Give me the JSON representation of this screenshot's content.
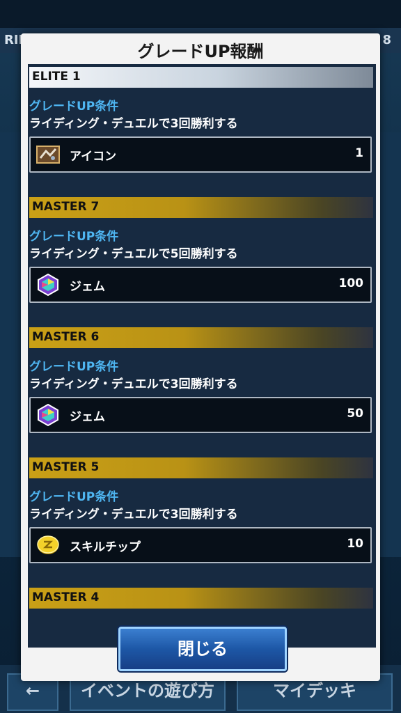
{
  "background": {
    "header_left": "RIDI",
    "header_right": "8",
    "nav_left": "イベントの遊び方",
    "nav_right": "マイデッキ"
  },
  "modal": {
    "title": "グレードUP報酬",
    "close_label": "閉じる",
    "sections": [
      {
        "grade": "ELITE 1",
        "style": "elite",
        "cond_title": "グレードUP条件",
        "cond_text": "ライディング・デュエルで3回勝利する",
        "reward": {
          "icon": "icon-card",
          "name": "アイコン",
          "qty": "1"
        }
      },
      {
        "grade": "MASTER 7",
        "style": "master",
        "cond_title": "グレードUP条件",
        "cond_text": "ライディング・デュエルで5回勝利する",
        "reward": {
          "icon": "gem-icon",
          "name": "ジェム",
          "qty": "100"
        }
      },
      {
        "grade": "MASTER 6",
        "style": "master",
        "cond_title": "グレードUP条件",
        "cond_text": "ライディング・デュエルで3回勝利する",
        "reward": {
          "icon": "gem-icon",
          "name": "ジェム",
          "qty": "50"
        }
      },
      {
        "grade": "MASTER 5",
        "style": "master",
        "cond_title": "グレードUP条件",
        "cond_text": "ライディング・デュエルで3回勝利する",
        "reward": {
          "icon": "skill-chip-icon",
          "name": "スキルチップ",
          "qty": "10"
        }
      },
      {
        "grade": "MASTER 4",
        "style": "master"
      }
    ]
  },
  "colors": {
    "accent_blue": "#4fb6f2",
    "gold": "#caa016",
    "panel": "#172a41"
  }
}
